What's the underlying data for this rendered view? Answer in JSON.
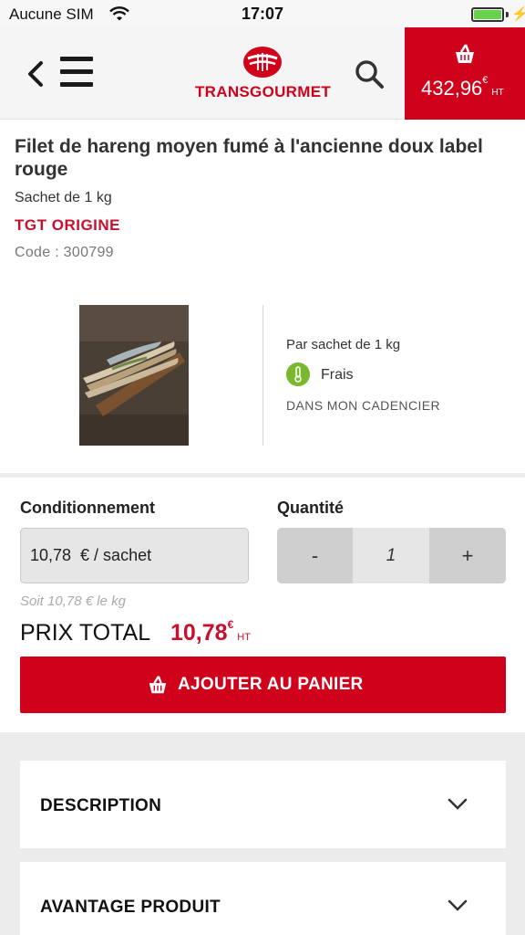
{
  "status_bar": {
    "carrier": "Aucune SIM",
    "time": "17:07"
  },
  "header": {
    "logo_text": "TRANSGOURMET",
    "cart_total_value": "432,96",
    "cart_total_currency": "€",
    "cart_total_suffix": "HT"
  },
  "product": {
    "title": "Filet de hareng moyen fumé à l'ancienne doux label rouge",
    "pack": "Sachet de 1 kg",
    "brand": "TGT ORIGINE",
    "code": "Code : 300799",
    "per_unit": "Par sachet de 1 kg",
    "storage": "Frais",
    "cadencier": "DANS MON CADENCIER"
  },
  "purchase": {
    "conditioning_label": "Conditionnement",
    "quantity_label": "Quantité",
    "conditioning_value": "10,78  € / sachet",
    "quantity_minus": "-",
    "quantity_value": "1",
    "quantity_plus": "+",
    "unit_price_kg": "Soit 10,78 € le kg",
    "total_label": "PRIX TOTAL",
    "total_value": "10,78",
    "total_currency": "€",
    "total_suffix": "HT",
    "add_button_label": "AJOUTER AU PANIER"
  },
  "accordions": [
    {
      "label": "DESCRIPTION"
    },
    {
      "label": "AVANTAGE PRODUIT"
    }
  ],
  "colors": {
    "brand_red": "#d0021b",
    "fresh_green": "#7cb82f"
  }
}
